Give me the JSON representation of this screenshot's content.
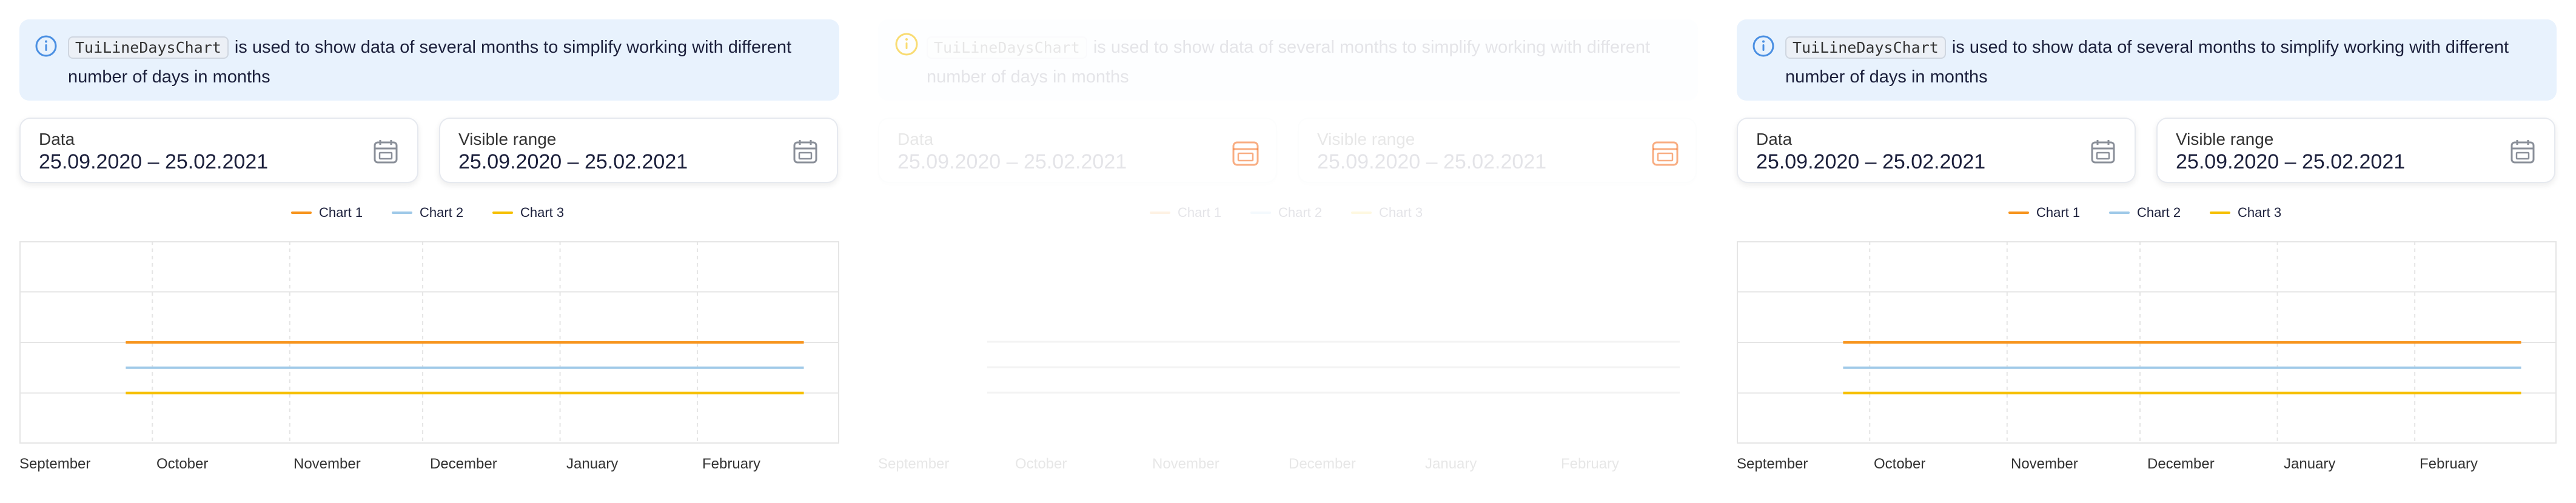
{
  "panels": [
    {
      "state": "default",
      "notice": {
        "code": "TuiLineDaysChart",
        "text": "is used to show data of several months to simplify working with different number of days in months"
      },
      "fields": [
        {
          "label": "Data",
          "value": "25.09.2020 – 25.02.2021"
        },
        {
          "label": "Visible range",
          "value": "25.09.2020 – 25.02.2021"
        }
      ],
      "legend": [
        "Chart 1",
        "Chart 2",
        "Chart 3"
      ],
      "months": [
        "September",
        "October",
        "November",
        "December",
        "January",
        "February"
      ]
    },
    {
      "state": "loading",
      "notice": {
        "code": "TuiLineDaysChart",
        "text": "is used to show data of several months to simplify working with different number of days in months"
      },
      "fields": [
        {
          "label": "Data",
          "value": "25.09.2020 – 25.02.2021"
        },
        {
          "label": "Visible range",
          "value": "25.09.2020 – 25.02.2021"
        }
      ],
      "legend": [
        "Chart 1",
        "Chart 2",
        "Chart 3"
      ],
      "months": [
        "September",
        "October",
        "November",
        "December",
        "January",
        "February"
      ]
    },
    {
      "state": "default",
      "notice": {
        "code": "TuiLineDaysChart",
        "text": "is used to show data of several months to simplify working with different number of days in months"
      },
      "fields": [
        {
          "label": "Data",
          "value": "25.09.2020 – 25.02.2021"
        },
        {
          "label": "Visible range",
          "value": "25.09.2020 – 25.02.2021"
        }
      ],
      "legend": [
        "Chart 1",
        "Chart 2",
        "Chart 3"
      ],
      "months": [
        "September",
        "October",
        "November",
        "December",
        "January",
        "February"
      ]
    }
  ],
  "colors": {
    "chart1": "#f7941d",
    "chart2": "#9fc9e8",
    "chart3": "#f6c000",
    "info": "#4a8fe2",
    "grid": "#e5e5e5",
    "accent_loading": "#f26a1b"
  },
  "icons": {
    "info": "info-icon",
    "calendar": "calendar-icon",
    "loader": "loader-icon"
  },
  "chart_data": {
    "type": "line",
    "x": [
      "2020-09-25",
      "2021-02-25"
    ],
    "x_tick_labels": [
      "September",
      "October",
      "November",
      "December",
      "January",
      "February"
    ],
    "series": [
      {
        "name": "Chart 1",
        "values": [
          0.5,
          0.5
        ]
      },
      {
        "name": "Chart 2",
        "values": [
          0.375,
          0.375
        ]
      },
      {
        "name": "Chart 3",
        "values": [
          0.25,
          0.25
        ]
      }
    ],
    "ylim": [
      0,
      1
    ],
    "grid": true,
    "legend": "top-center"
  }
}
